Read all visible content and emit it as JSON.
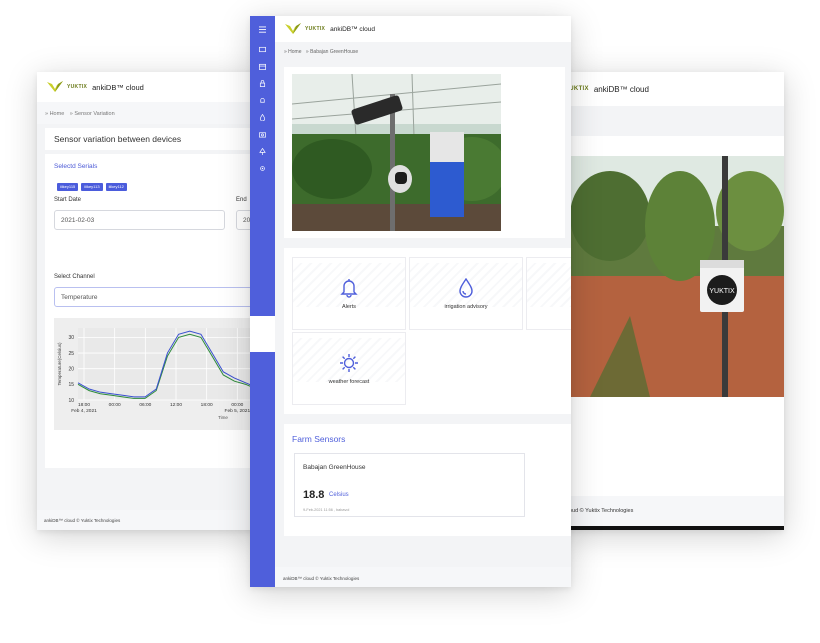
{
  "colors": {
    "accent": "#4f5fdb",
    "chip": "#4b5cdc",
    "line_green": "#2e8b3a",
    "line_blue": "#3a4fd0"
  },
  "left": {
    "brand": "YUKTIX",
    "app_title": "ankiDB™ cloud",
    "breadcrumb": [
      "» Home",
      "» Sensor Variation"
    ],
    "panel_title": "Sensor variation between devices",
    "selected_label": "Selectd Serials",
    "chips": [
      "iiikey115",
      "iiikey113",
      "iiikey112"
    ],
    "start_date_label": "Start Date",
    "start_date_value": "2021-02-03",
    "end_date_label": "End",
    "end_date_value": "20",
    "channel_label": "Select Channel",
    "channel_placeholder": "Temperature",
    "footer": "ankiDB™ cloud © Yuktix Technologies"
  },
  "chart_data": {
    "type": "line",
    "ylabel": "Temperature(Celsius)",
    "xlabel": "Time",
    "x_ticks": [
      "18:00",
      "00:00",
      "06:00",
      "12:00",
      "18:00",
      "00:00",
      "06:00"
    ],
    "x_subticks": [
      "Feb 4, 2021",
      "",
      "",
      "",
      "",
      "Feb 5, 2021",
      ""
    ],
    "y_ticks": [
      10,
      15,
      20,
      25,
      30
    ],
    "ylim": [
      10,
      33
    ],
    "series": [
      {
        "values": [
          15,
          13,
          12,
          11.5,
          11,
          10.5,
          10.5,
          13,
          24,
          30,
          31,
          30,
          24,
          18,
          16,
          15,
          13.5,
          13
        ]
      },
      {
        "values": [
          15.5,
          13.5,
          12.5,
          12,
          11.5,
          11,
          11,
          13.5,
          25,
          31,
          32,
          31,
          25,
          19,
          17,
          15.5,
          14,
          13.5
        ]
      }
    ]
  },
  "center": {
    "brand": "YUKTIX",
    "app_title": "ankiDB™ cloud",
    "breadcrumb": [
      "» Home",
      "» Babajan GreenHouse"
    ],
    "tiles": [
      {
        "label": "Alerts",
        "icon": "bell-icon"
      },
      {
        "label": "irrigation advisory",
        "icon": "water-drop-icon"
      },
      {
        "label": "weather forecast",
        "icon": "sun-icon"
      }
    ],
    "farm_sensors_title": "Farm Sensors",
    "sensor_name": "Babajan GreenHouse",
    "sensor_value": "18.8",
    "sensor_unit": "Celsius",
    "sensor_time": "9-Feb-2021 11:56 , babavol",
    "footer": "ankiDB™ cloud © Yuktix Technologies",
    "sidebar_icons": [
      "menu-icon",
      "inbox-icon",
      "calendar-icon",
      "lock-icon",
      "bell-icon",
      "drop-icon",
      "camera-icon",
      "tree-icon",
      "gear-icon"
    ]
  },
  "right": {
    "brand": "YUKTIX",
    "app_title": "ankiDB™ cloud",
    "heading_partial": "B",
    "sub_partial": "C",
    "loc_partial": "C",
    "device_text": "YUKTIX",
    "footer": "cloud © Yuktix Technologies"
  }
}
